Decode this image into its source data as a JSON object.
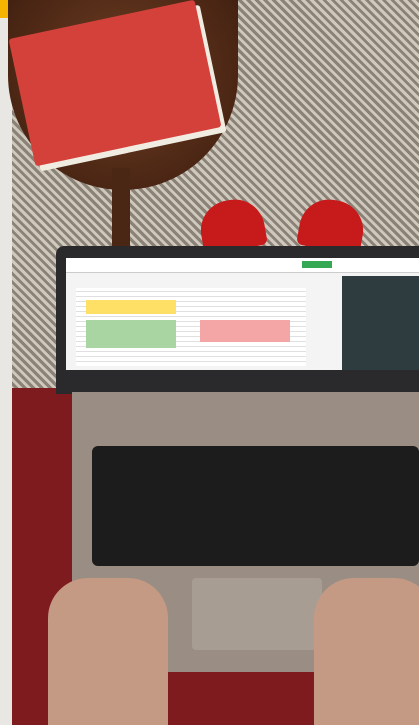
{
  "photo": {
    "subject": ""
  }
}
